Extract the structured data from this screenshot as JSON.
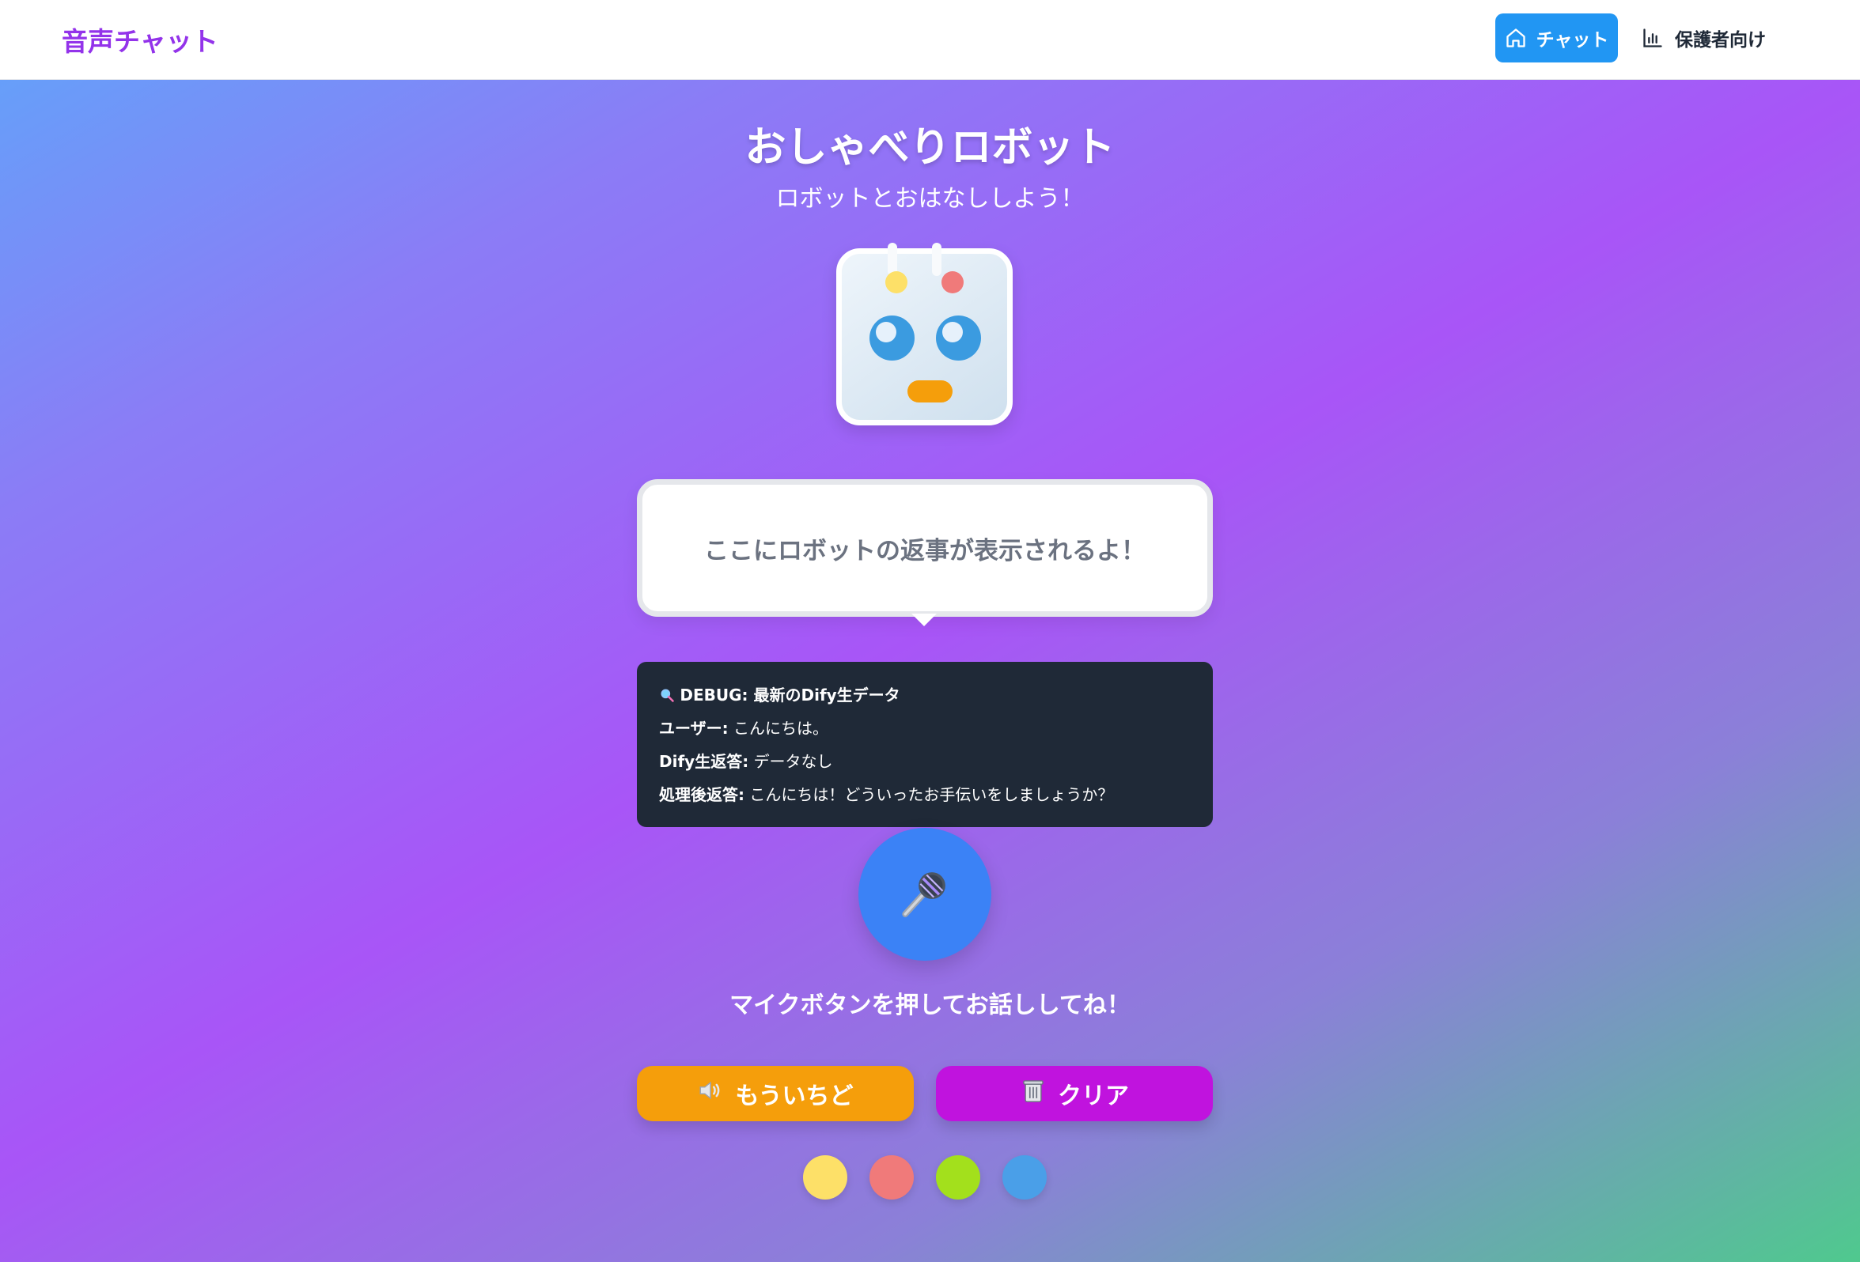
{
  "header": {
    "brand": "音声チャット",
    "nav": [
      {
        "label": "チャット",
        "icon": "home-icon",
        "active": true
      },
      {
        "label": "保護者向け",
        "icon": "bar-chart-icon",
        "active": false
      }
    ]
  },
  "main": {
    "title": "おしゃべりロボット",
    "subtitle": "ロボットとおはなししよう！",
    "bubble_text": "ここにロボットの返事が表示されるよ！",
    "debug": {
      "heading_icon": "magnifier-icon",
      "heading": "DEBUG: 最新のDify生データ",
      "rows": [
        {
          "label": "ユーザー:",
          "value": "こんにちは。"
        },
        {
          "label": "Dify生返答:",
          "value": "データなし"
        },
        {
          "label": "処理後返答:",
          "value": "こんにちは！どういったお手伝いをしましょうか？"
        }
      ]
    },
    "mic_icon": "microphone-icon",
    "hint": "マイクボタンを押してお話ししてね！",
    "buttons": {
      "again": {
        "label": "もういちど",
        "icon": "speaker-icon"
      },
      "clear": {
        "label": "クリア",
        "icon": "trash-icon"
      }
    },
    "color_dots": [
      "#fde068",
      "#f07a7a",
      "#a3e01c",
      "#4a9fe8"
    ]
  },
  "colors": {
    "brand": "#9333ea",
    "nav_active": "#2196f3",
    "mic": "#3b82f6",
    "again_button": "#f59e0b",
    "clear_button": "#c013de",
    "debug_bg": "#1f2937"
  }
}
